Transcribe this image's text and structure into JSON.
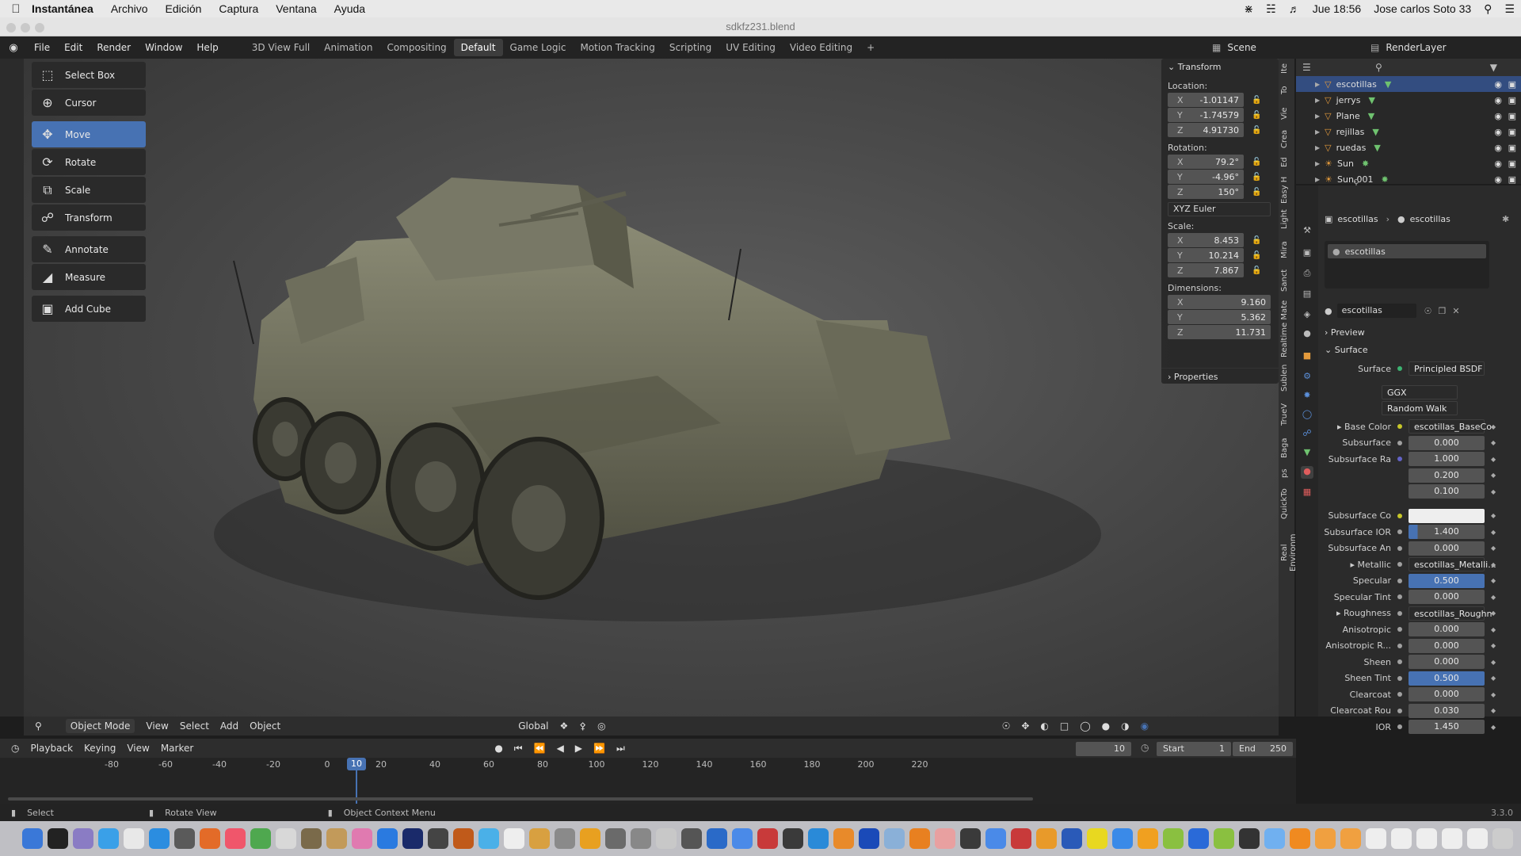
{
  "mac": {
    "app": "Instantánea",
    "menus": [
      "Archivo",
      "Edición",
      "Captura",
      "Ventana",
      "Ayuda"
    ],
    "clock": "Jue 18:56",
    "user": "Jose carlos Soto 33"
  },
  "window": {
    "title": "sdkfz231.blend"
  },
  "blender": {
    "menus": [
      "File",
      "Edit",
      "Render",
      "Window",
      "Help"
    ],
    "workspaces": [
      "3D View Full",
      "Animation",
      "Compositing",
      "Default",
      "Game Logic",
      "Motion Tracking",
      "Scripting",
      "UV Editing",
      "Video Editing"
    ],
    "active_workspace": "Default",
    "scene": "Scene",
    "renderlayer": "RenderLayer"
  },
  "toolbar": [
    "Select Box",
    "Cursor",
    "Move",
    "Rotate",
    "Scale",
    "Transform",
    "Annotate",
    "Measure",
    "Add Cube"
  ],
  "active_tool": "Move",
  "transform": {
    "title": "Transform",
    "location_label": "Location:",
    "location": [
      "-1.01147",
      "-1.74579",
      "4.91730"
    ],
    "rotation_label": "Rotation:",
    "rotation": [
      "79.2°",
      "-4.96°",
      "150°"
    ],
    "rotation_mode": "XYZ Euler",
    "scale_label": "Scale:",
    "scale": [
      "8.453",
      "10.214",
      "7.867"
    ],
    "dimensions_label": "Dimensions:",
    "dimensions": [
      "9.160",
      "5.362",
      "11.731"
    ],
    "axes": [
      "X",
      "Y",
      "Z"
    ],
    "properties": "Properties"
  },
  "side_tabs": [
    "Ite",
    "To",
    "Vie",
    "Crea",
    "Ed",
    "Easy H",
    "Light",
    "Mira",
    "Sanct",
    "Realtime Mate",
    "Sublen",
    "TrueV",
    "Baga",
    "ps",
    "QuickTo",
    "Real Environm"
  ],
  "outliner": [
    {
      "name": "escotillas",
      "type": "mesh",
      "selected": true
    },
    {
      "name": "jerrys",
      "type": "mesh"
    },
    {
      "name": "Plane",
      "type": "mesh"
    },
    {
      "name": "rejillas",
      "type": "mesh"
    },
    {
      "name": "ruedas",
      "type": "mesh"
    },
    {
      "name": "Sun",
      "type": "light"
    },
    {
      "name": "Sun.001",
      "type": "light"
    }
  ],
  "material": {
    "breadcrumb_object": "escotillas",
    "breadcrumb_material": "escotillas",
    "slot": "escotillas",
    "datablock": "escotillas",
    "preview": "Preview",
    "surface_section": "Surface",
    "surface_label": "Surface",
    "surface_shader": "Principled BSDF",
    "distribution": "GGX",
    "subsurface_method": "Random Walk",
    "fields": [
      {
        "label": "Base Color",
        "value": "escotillas_BaseCo",
        "kind": "link",
        "dot": "y",
        "expand": true
      },
      {
        "label": "Subsurface",
        "value": "0.000",
        "kind": "num",
        "dot": "g"
      },
      {
        "label": "Subsurface Ra",
        "value": "1.000",
        "kind": "num",
        "dot": "p"
      },
      {
        "label": "",
        "value": "0.200",
        "kind": "num"
      },
      {
        "label": "",
        "value": "0.100",
        "kind": "num"
      },
      {
        "label": "Subsurface Co",
        "value": "",
        "kind": "white",
        "dot": "y"
      },
      {
        "label": "Subsurface IOR",
        "value": "1.400",
        "kind": "half",
        "dot": "g"
      },
      {
        "label": "Subsurface An",
        "value": "0.000",
        "kind": "num",
        "dot": "g"
      },
      {
        "label": "Metallic",
        "value": "escotillas_Metalli...",
        "kind": "link",
        "dot": "g",
        "expand": true
      },
      {
        "label": "Specular",
        "value": "0.500",
        "kind": "blue",
        "dot": "g"
      },
      {
        "label": "Specular Tint",
        "value": "0.000",
        "kind": "num",
        "dot": "g"
      },
      {
        "label": "Roughness",
        "value": "escotillas_Roughn",
        "kind": "link",
        "dot": "g",
        "expand": true
      },
      {
        "label": "Anisotropic",
        "value": "0.000",
        "kind": "num",
        "dot": "g"
      },
      {
        "label": "Anisotropic R...",
        "value": "0.000",
        "kind": "num",
        "dot": "g"
      },
      {
        "label": "Sheen",
        "value": "0.000",
        "kind": "num",
        "dot": "g"
      },
      {
        "label": "Sheen Tint",
        "value": "0.500",
        "kind": "blue",
        "dot": "g"
      },
      {
        "label": "Clearcoat",
        "value": "0.000",
        "kind": "num",
        "dot": "g"
      },
      {
        "label": "Clearcoat Rou",
        "value": "0.030",
        "kind": "num",
        "dot": "g"
      },
      {
        "label": "IOR",
        "value": "1.450",
        "kind": "num",
        "dot": "g"
      }
    ]
  },
  "viewport_header": {
    "mode": "Object Mode",
    "menus": [
      "View",
      "Select",
      "Add",
      "Object"
    ],
    "orientation": "Global"
  },
  "timeline": {
    "menus": [
      "Playback",
      "Keying",
      "View",
      "Marker"
    ],
    "current_frame": "10",
    "start_label": "Start",
    "start": "1",
    "end_label": "End",
    "end": "250",
    "ticks": [
      "-80",
      "-60",
      "-40",
      "-20",
      "0",
      "10",
      "20",
      "40",
      "60",
      "80",
      "100",
      "120",
      "140",
      "160",
      "180",
      "200",
      "220"
    ]
  },
  "status": {
    "left": "Select",
    "middle": "Rotate View",
    "right": "Object Context Menu",
    "version": "3.3.0"
  },
  "colors": {
    "accent": "#4772b3",
    "selected_row": "#334d80"
  }
}
